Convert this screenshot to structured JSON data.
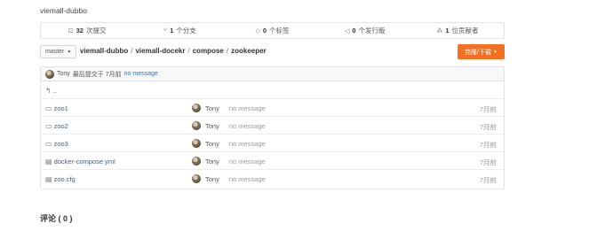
{
  "repo": {
    "name": "viemall-dubbo"
  },
  "stats": [
    {
      "icon": "commit-icon",
      "glyph": "⊡",
      "count": "32",
      "label": "次提交"
    },
    {
      "icon": "branch-icon",
      "glyph": "⑂",
      "count": "1",
      "label": "个分支"
    },
    {
      "icon": "tag-icon",
      "glyph": "◇",
      "count": "0",
      "label": "个标签"
    },
    {
      "icon": "release-icon",
      "glyph": "◁",
      "count": "0",
      "label": "个发行版"
    },
    {
      "icon": "contributor-icon",
      "glyph": "⁂",
      "count": "1",
      "label": "位贡献者"
    }
  ],
  "branch": {
    "name": "master",
    "caret": "▼"
  },
  "breadcrumb": {
    "segments": [
      "viemall-dubbo",
      "viemall-docekr",
      "compose",
      "zookeeper"
    ],
    "separator": "/"
  },
  "clone_button": {
    "label": "克隆/下载",
    "caret": "▼"
  },
  "last_commit": {
    "author": "Tony",
    "text": "最后提交于 7月前",
    "message": "no message"
  },
  "parent_dir": {
    "label": "..",
    "glyph": "↰"
  },
  "files": [
    {
      "name": "zoo1",
      "type": "folder",
      "glyph": "▭",
      "author": "Tony",
      "message": "no message",
      "time": "7月前"
    },
    {
      "name": "zoo2",
      "type": "folder",
      "glyph": "▭",
      "author": "Tony",
      "message": "no message",
      "time": "7月前"
    },
    {
      "name": "zoo3",
      "type": "folder",
      "glyph": "▭",
      "author": "Tony",
      "message": "no message",
      "time": "7月前"
    },
    {
      "name": "docker-compose.yml",
      "type": "file",
      "glyph": "▤",
      "author": "Tony",
      "message": "no message",
      "time": "7月前"
    },
    {
      "name": "zoo.cfg",
      "type": "file",
      "glyph": "▤",
      "author": "Tony",
      "message": "no message",
      "time": "7月前"
    }
  ],
  "comments": {
    "title": "评论 ( 0 )"
  },
  "colors": {
    "accent": "#f47023",
    "link": "#3b6fb0"
  }
}
